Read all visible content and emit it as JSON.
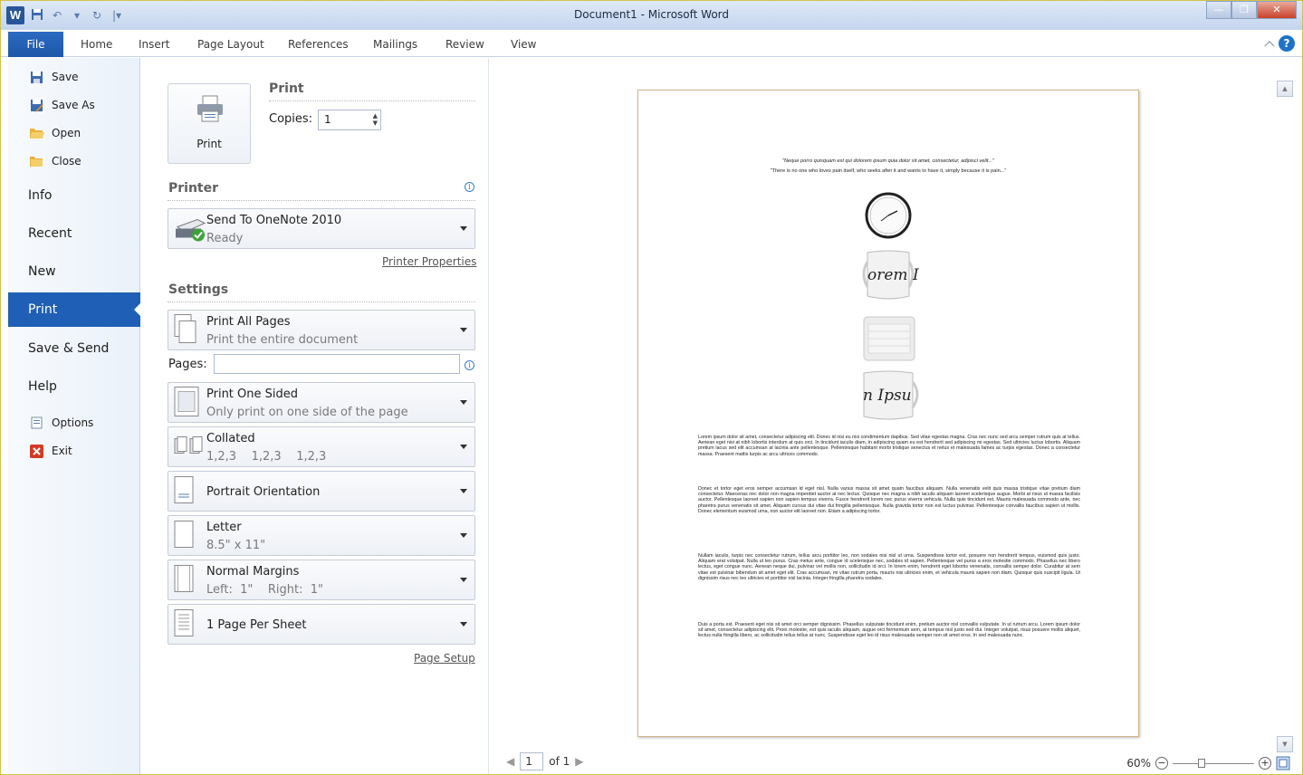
{
  "window": {
    "title": "Document1 - Microsoft Word"
  },
  "ribbon": {
    "file_label": "File",
    "tabs": [
      "Home",
      "Insert",
      "Page Layout",
      "References",
      "Mailings",
      "Review",
      "View"
    ]
  },
  "backstage": {
    "commands": [
      {
        "label": "Save",
        "icon": "save-icon"
      },
      {
        "label": "Save As",
        "icon": "save-as-icon"
      },
      {
        "label": "Open",
        "icon": "open-folder-icon"
      },
      {
        "label": "Close",
        "icon": "close-folder-icon"
      }
    ],
    "sections": [
      "Info",
      "Recent",
      "New",
      "Print",
      "Save & Send",
      "Help"
    ],
    "active_section": "Print",
    "bottom": [
      {
        "label": "Options",
        "icon": "options-icon"
      },
      {
        "label": "Exit",
        "icon": "exit-icon"
      }
    ]
  },
  "print": {
    "heading": "Print",
    "button_label": "Print",
    "copies_label": "Copies:",
    "copies_value": "1",
    "printer_heading": "Printer",
    "printer_name": "Send To OneNote 2010",
    "printer_status": "Ready",
    "printer_properties": "Printer Properties",
    "settings_heading": "Settings",
    "pages_label": "Pages:",
    "pages_value": "",
    "settings": [
      {
        "title": "Print All Pages",
        "subtitle": "Print the entire document"
      },
      {
        "title": "Print One Sided",
        "subtitle": "Only print on one side of the page"
      },
      {
        "title": "Collated",
        "subtitle": "1,2,3    1,2,3    1,2,3"
      },
      {
        "title": "Portrait Orientation",
        "subtitle": ""
      },
      {
        "title": "Letter",
        "subtitle": "8.5\" x 11\""
      },
      {
        "title": "Normal Margins",
        "subtitle": "Left:  1\"    Right:  1\""
      },
      {
        "title": "1 Page Per Sheet",
        "subtitle": ""
      }
    ],
    "page_setup": "Page Setup"
  },
  "preview": {
    "quote1": "\"Neque porro quisquam est qui dolorem ipsum quia dolor sit amet, consectetur, adipisci velit...\"",
    "quote2": "\"There is no one who loves pain itself, who seeks after it and wants to have it, simply because it is pain...\"",
    "mug1_text": "orem I",
    "mug2_text": "n Ipsu",
    "paragraphs": [
      "Lorem ipsum dolor sit amet, consectetur adipiscing elit. Donec id nisi eu nisi condimentum dapibus. Sed vitae egestas magna. Cras nec nunc sed arcu semper rutrum quis at tellus. Aenean eget nisi at nibh lobortis interdum at quis orci. In tincidunt iaculis diam, in adipiscing quam eu est hendrerit sed adipiscing mi egestas. Sed ultricies luctus lobortis. Aliquam pretium lacus sed elit accumsan at lacinia ante pellentesque. Pellentesque habitant morbi tristique senectus et netus et malesuada fames ac turpis egestas. Donec a consectetur massa. Praesent mattis turpis ac arcu ultrices commodo.",
      "Donec et tortor eget eros semper accumsan id eget nisl. Nulla varius massa sit amet quam faucibus aliquam. Nulla venenatis velit quis massa tristique vitae pretium diam consectetur. Maecenas nec dolor non magna imperdiet auctor at nec lectus. Quisque nec magna a nibh iaculis aliquam laoreet scelerisque augue. Morbi at risus ut massa facilisis auctor. Pellentesque laoreet sapien non sapien tempus viverra. Fusce hendrerit lorem nec purus viverra vehicula. Nulla quis tincidunt est. Mauris malesuada commodo ante, nec pharetra purus venenatis sit amet. Aliquam cursus dui vitae dui fringilla pellentesque. Nulla gravida tortor non est luctus pulvinar. Pellentesque convallis faucibus sapien ut mollis. Donec elementum euismod urna, non auctor elit laoreet non. Etiam a adipiscing tortor.",
      "Nullam iaculis, turpis nec consectetur rutrum, tellus arcu porttitor leo, non sodales nisi nisl ut urna. Suspendisse tortor est, posuere non hendrerit tempus, euismod quis justo. Aliquam erat volutpat. Nulla ut leo purus. Cras metus ante, congue id scelerisque nec, sodales id sapien. Pellentesque vel purus a eros molestie commodo. Phasellus nec libero lectus, eget congue nunc. Aenean neque dui, pulvinar vel mollis non, sollicitudin id orci. In lorem enim, hendrerit eget lobortis venenatis, convallis semper dolor. Curabitur at sem vitae est pulvinar bibendum sit amet eget elit. Cras accumsan, mi vitae rutrum porta, mauris nisi ultricies enim, et vehicula mauris sapien non diam. Quisque quis suscipit ligula. Ut dignissim risus nec leo ultricies et porttitor nisl lacinia. Integer fringilla pharetra sodales.",
      "Duis a porta est. Praesent eget nisi sit amet orci semper dignissim. Phasellus vulputate tincidunt enim, pretium auctor nisl convallis vulputate. In ut rutrum arcu. Lorem ipsum dolor sit amet, consectetur adipiscing elit. Proin molestie, est quis iaculis aliquam, augue orci fermentum sem, at tempus nisl justo sed dui. Integer volutpat, risus posuere mollis aliquet, lectus nulla fringilla libero, ac sollicitudin tellus tellus at nunc. Suspendisse eget leo id risus malesuada semper non sit amet eros. In sed malesuada nunc."
    ],
    "page_current": "1",
    "page_total": "of 1",
    "zoom": "60%"
  }
}
